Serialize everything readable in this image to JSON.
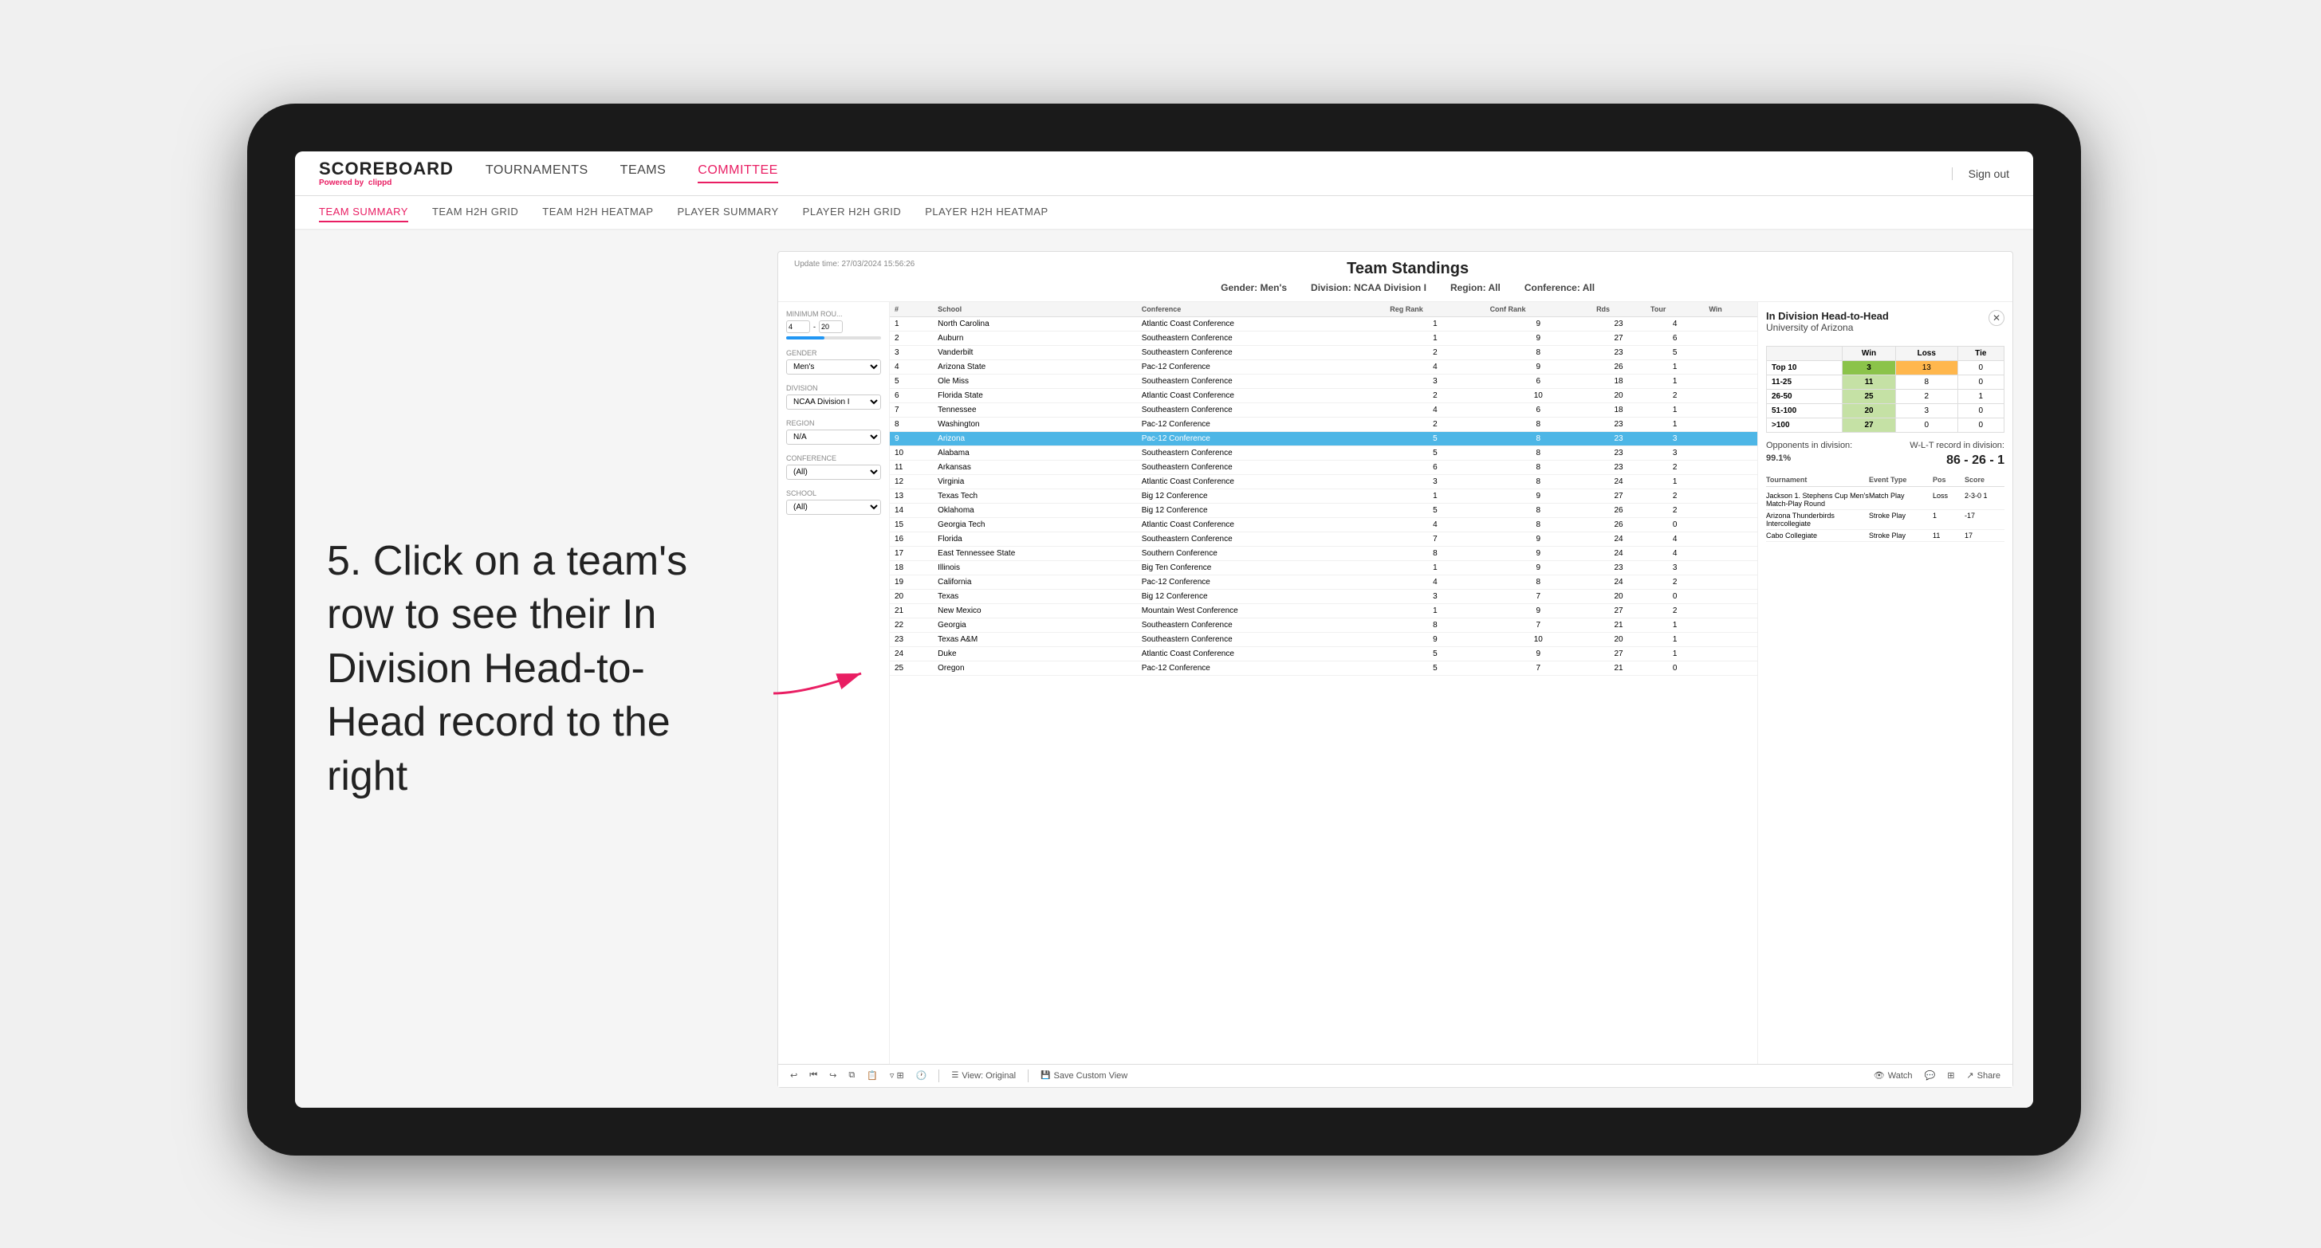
{
  "annotation": {
    "step": "5. Click on a team's row to see their In Division Head-to-Head record to the right"
  },
  "topNav": {
    "logo": "SCOREBOARD",
    "logoPowered": "Powered by",
    "logoApp": "clippd",
    "items": [
      "TOURNAMENTS",
      "TEAMS",
      "COMMITTEE"
    ],
    "activeItem": "COMMITTEE",
    "signOut": "Sign out"
  },
  "subNav": {
    "items": [
      "TEAM SUMMARY",
      "TEAM H2H GRID",
      "TEAM H2H HEATMAP",
      "PLAYER SUMMARY",
      "PLAYER H2H GRID",
      "PLAYER H2H HEATMAP"
    ],
    "activeItem": "PLAYER SUMMARY"
  },
  "panel": {
    "updateTime": "Update time:",
    "updateDate": "27/03/2024 15:56:26",
    "title": "Team Standings",
    "filters": {
      "gender": "Gender: Men's",
      "division": "Division: NCAA Division I",
      "region": "Region: All",
      "conference": "Conference: All"
    }
  },
  "sidebarFilters": {
    "minRoundsLabel": "Minimum Rou...",
    "minRoundsValue": "4",
    "minRoundsMax": "20",
    "genderLabel": "Gender",
    "genderValue": "Men's",
    "divisionLabel": "Division",
    "divisionValue": "NCAA Division I",
    "regionLabel": "Region",
    "regionValue": "N/A",
    "conferenceLabel": "Conference",
    "conferenceValue": "(All)",
    "schoolLabel": "School",
    "schoolValue": "(All)"
  },
  "tableColumns": [
    "#",
    "School",
    "Conference",
    "Reg Rank",
    "Conf Rank",
    "Rds",
    "Tour",
    "Win"
  ],
  "tableRows": [
    {
      "rank": 1,
      "school": "North Carolina",
      "conference": "Atlantic Coast Conference",
      "regRank": 1,
      "confRank": 9,
      "rds": 23,
      "tour": 4,
      "win": null
    },
    {
      "rank": 2,
      "school": "Auburn",
      "conference": "Southeastern Conference",
      "regRank": 1,
      "confRank": 9,
      "rds": 27,
      "tour": 6,
      "win": null
    },
    {
      "rank": 3,
      "school": "Vanderbilt",
      "conference": "Southeastern Conference",
      "regRank": 2,
      "confRank": 8,
      "rds": 23,
      "tour": 5,
      "win": null
    },
    {
      "rank": 4,
      "school": "Arizona State",
      "conference": "Pac-12 Conference",
      "regRank": 4,
      "confRank": 9,
      "rds": 26,
      "tour": 1,
      "win": null
    },
    {
      "rank": 5,
      "school": "Ole Miss",
      "conference": "Southeastern Conference",
      "regRank": 3,
      "confRank": 6,
      "rds": 18,
      "tour": 1,
      "win": null
    },
    {
      "rank": 6,
      "school": "Florida State",
      "conference": "Atlantic Coast Conference",
      "regRank": 2,
      "confRank": 10,
      "rds": 20,
      "tour": 2,
      "win": null
    },
    {
      "rank": 7,
      "school": "Tennessee",
      "conference": "Southeastern Conference",
      "regRank": 4,
      "confRank": 6,
      "rds": 18,
      "tour": 1,
      "win": null
    },
    {
      "rank": 8,
      "school": "Washington",
      "conference": "Pac-12 Conference",
      "regRank": 2,
      "confRank": 8,
      "rds": 23,
      "tour": 1,
      "win": null
    },
    {
      "rank": 9,
      "school": "Arizona",
      "conference": "Pac-12 Conference",
      "regRank": 5,
      "confRank": 8,
      "rds": 23,
      "tour": 3,
      "win": null,
      "highlighted": true
    },
    {
      "rank": 10,
      "school": "Alabama",
      "conference": "Southeastern Conference",
      "regRank": 5,
      "confRank": 8,
      "rds": 23,
      "tour": 3,
      "win": null
    },
    {
      "rank": 11,
      "school": "Arkansas",
      "conference": "Southeastern Conference",
      "regRank": 6,
      "confRank": 8,
      "rds": 23,
      "tour": 2,
      "win": null
    },
    {
      "rank": 12,
      "school": "Virginia",
      "conference": "Atlantic Coast Conference",
      "regRank": 3,
      "confRank": 8,
      "rds": 24,
      "tour": 1,
      "win": null
    },
    {
      "rank": 13,
      "school": "Texas Tech",
      "conference": "Big 12 Conference",
      "regRank": 1,
      "confRank": 9,
      "rds": 27,
      "tour": 2,
      "win": null
    },
    {
      "rank": 14,
      "school": "Oklahoma",
      "conference": "Big 12 Conference",
      "regRank": 5,
      "confRank": 8,
      "rds": 26,
      "tour": 2,
      "win": null
    },
    {
      "rank": 15,
      "school": "Georgia Tech",
      "conference": "Atlantic Coast Conference",
      "regRank": 4,
      "confRank": 8,
      "rds": 26,
      "tour": 0,
      "win": null
    },
    {
      "rank": 16,
      "school": "Florida",
      "conference": "Southeastern Conference",
      "regRank": 7,
      "confRank": 9,
      "rds": 24,
      "tour": 4,
      "win": null
    },
    {
      "rank": 17,
      "school": "East Tennessee State",
      "conference": "Southern Conference",
      "regRank": 8,
      "confRank": 9,
      "rds": 24,
      "tour": 4,
      "win": null
    },
    {
      "rank": 18,
      "school": "Illinois",
      "conference": "Big Ten Conference",
      "regRank": 1,
      "confRank": 9,
      "rds": 23,
      "tour": 3,
      "win": null
    },
    {
      "rank": 19,
      "school": "California",
      "conference": "Pac-12 Conference",
      "regRank": 4,
      "confRank": 8,
      "rds": 24,
      "tour": 2,
      "win": null
    },
    {
      "rank": 20,
      "school": "Texas",
      "conference": "Big 12 Conference",
      "regRank": 3,
      "confRank": 7,
      "rds": 20,
      "tour": 0,
      "win": null
    },
    {
      "rank": 21,
      "school": "New Mexico",
      "conference": "Mountain West Conference",
      "regRank": 1,
      "confRank": 9,
      "rds": 27,
      "tour": 2,
      "win": null
    },
    {
      "rank": 22,
      "school": "Georgia",
      "conference": "Southeastern Conference",
      "regRank": 8,
      "confRank": 7,
      "rds": 21,
      "tour": 1,
      "win": null
    },
    {
      "rank": 23,
      "school": "Texas A&M",
      "conference": "Southeastern Conference",
      "regRank": 9,
      "confRank": 10,
      "rds": 20,
      "tour": 1,
      "win": null
    },
    {
      "rank": 24,
      "school": "Duke",
      "conference": "Atlantic Coast Conference",
      "regRank": 5,
      "confRank": 9,
      "rds": 27,
      "tour": 1,
      "win": null
    },
    {
      "rank": 25,
      "school": "Oregon",
      "conference": "Pac-12 Conference",
      "regRank": 5,
      "confRank": 7,
      "rds": 21,
      "tour": 0,
      "win": null
    }
  ],
  "h2h": {
    "title": "In Division Head-to-Head",
    "team": "University of Arizona",
    "tableHeaders": [
      "",
      "Win",
      "Loss",
      "Tie"
    ],
    "tableRows": [
      {
        "label": "Top 10",
        "win": 3,
        "loss": 13,
        "tie": 0,
        "winColor": "green",
        "lossColor": "orange"
      },
      {
        "label": "11-25",
        "win": 11,
        "loss": 8,
        "tie": 0,
        "winColor": "light-green",
        "lossColor": "white"
      },
      {
        "label": "26-50",
        "win": 25,
        "loss": 2,
        "tie": 1,
        "winColor": "light-green",
        "lossColor": "white"
      },
      {
        "label": "51-100",
        "win": 20,
        "loss": 3,
        "tie": 0,
        "winColor": "light-green",
        "lossColor": "white"
      },
      {
        "label": ">100",
        "win": 27,
        "loss": 0,
        "tie": 0,
        "winColor": "light-green",
        "lossColor": "white"
      }
    ],
    "opponentsLabel": "Opponents in division:",
    "opponentsValue": "99.1%",
    "wltLabel": "W-L-T record in division:",
    "wltValue": "86 - 26 - 1",
    "tournamentHeaders": [
      "Tournament",
      "Event Type",
      "Pos",
      "Score"
    ],
    "tournaments": [
      {
        "name": "Jackson 1. Stephens Cup Men's Match-Play Round",
        "eventType": "Match Play",
        "pos": "Loss",
        "score": "2-3-0",
        "rowNum": 1
      },
      {
        "name": "Arizona Thunderbirds Intercollegiate",
        "eventType": "Stroke Play",
        "pos": "1",
        "score": "-17"
      },
      {
        "name": "Cabo Collegiate",
        "eventType": "Stroke Play",
        "pos": "11",
        "score": "17"
      }
    ]
  },
  "toolbar": {
    "undo": "↩",
    "redo": "↪",
    "viewOriginal": "View: Original",
    "saveCustomView": "Save Custom View",
    "watch": "Watch",
    "share": "Share"
  },
  "colors": {
    "accent": "#e91e63",
    "highlightedRow": "#4db6e6",
    "greenCell": "#8bc34a",
    "lightGreenCell": "#c5e1a5",
    "orangeCell": "#ffb74d"
  }
}
